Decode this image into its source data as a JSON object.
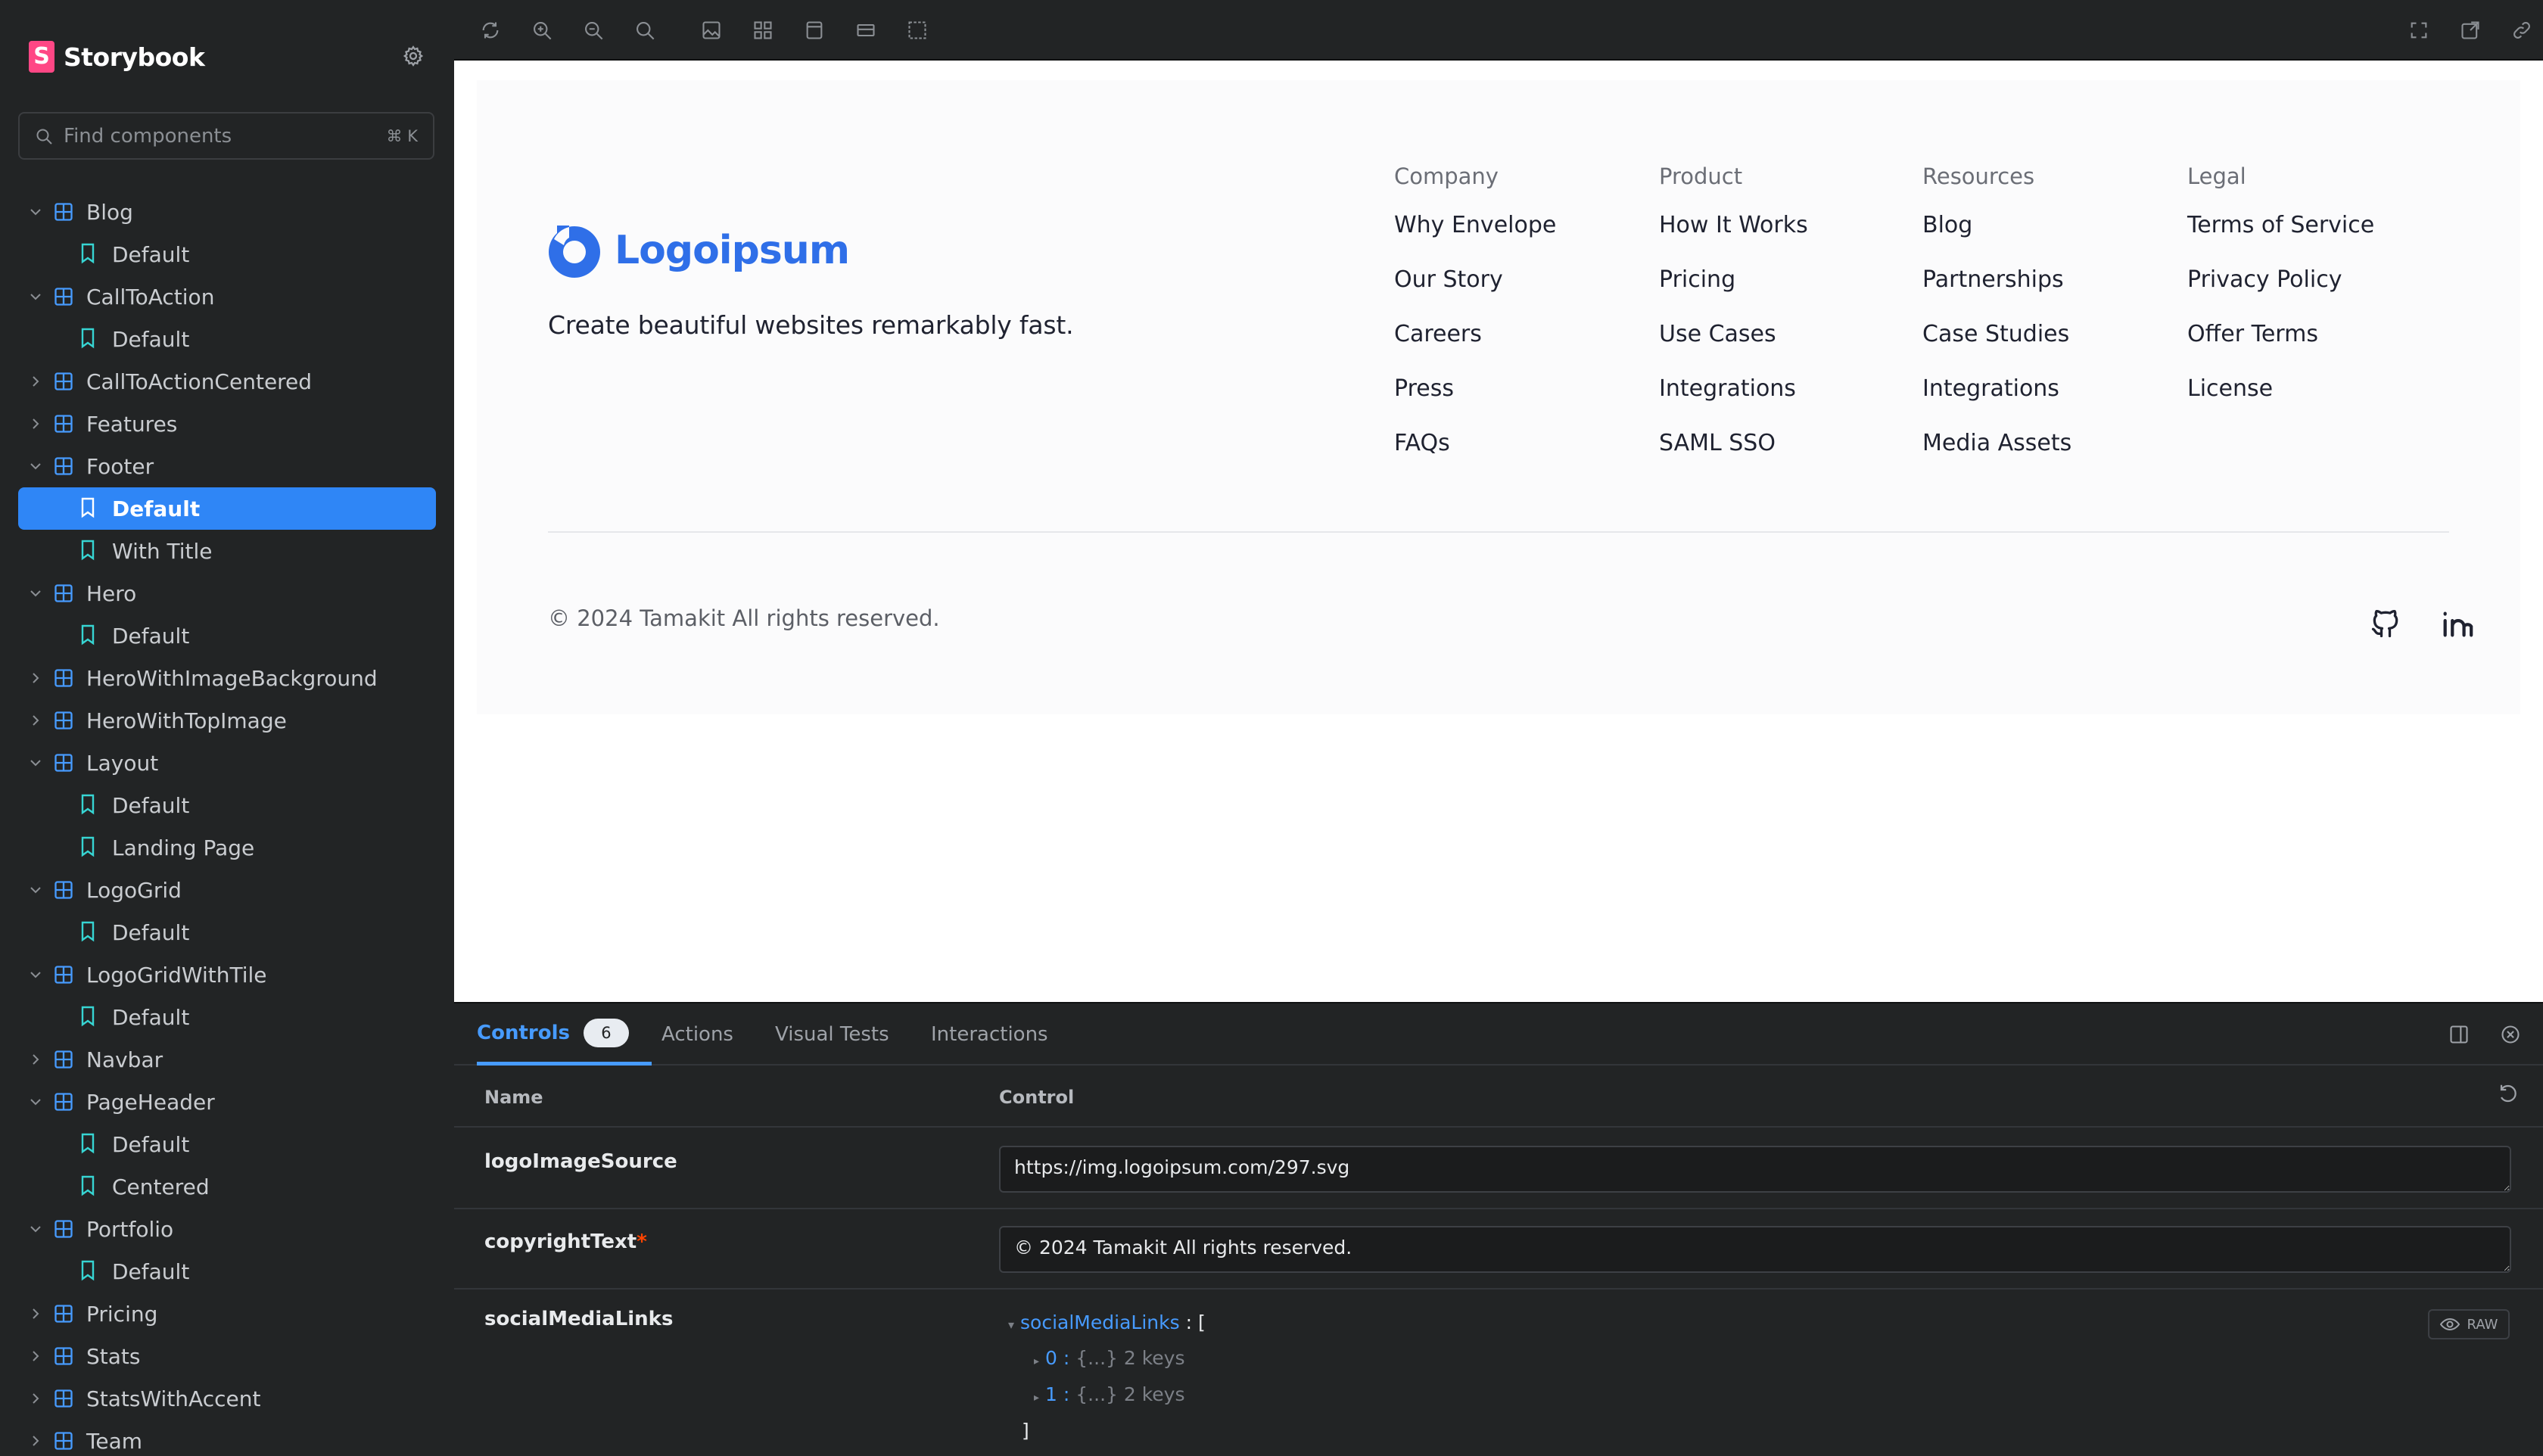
{
  "sidebar": {
    "brand": "Storybook",
    "search_placeholder": "Find components",
    "search_shortcut": "⌘ K",
    "items": [
      {
        "type": "component",
        "label": "Blog",
        "expanded": true
      },
      {
        "type": "story",
        "label": "Default"
      },
      {
        "type": "component",
        "label": "CallToAction",
        "expanded": true
      },
      {
        "type": "story",
        "label": "Default"
      },
      {
        "type": "component",
        "label": "CallToActionCentered",
        "expanded": false
      },
      {
        "type": "component",
        "label": "Features",
        "expanded": false
      },
      {
        "type": "component",
        "label": "Footer",
        "expanded": true
      },
      {
        "type": "story",
        "label": "Default",
        "selected": true
      },
      {
        "type": "story",
        "label": "With Title"
      },
      {
        "type": "component",
        "label": "Hero",
        "expanded": true
      },
      {
        "type": "story",
        "label": "Default"
      },
      {
        "type": "component",
        "label": "HeroWithImageBackground",
        "expanded": false
      },
      {
        "type": "component",
        "label": "HeroWithTopImage",
        "expanded": false
      },
      {
        "type": "component",
        "label": "Layout",
        "expanded": true
      },
      {
        "type": "story",
        "label": "Default"
      },
      {
        "type": "story",
        "label": "Landing Page"
      },
      {
        "type": "component",
        "label": "LogoGrid",
        "expanded": true
      },
      {
        "type": "story",
        "label": "Default"
      },
      {
        "type": "component",
        "label": "LogoGridWithTile",
        "expanded": true
      },
      {
        "type": "story",
        "label": "Default"
      },
      {
        "type": "component",
        "label": "Navbar",
        "expanded": false
      },
      {
        "type": "component",
        "label": "PageHeader",
        "expanded": true
      },
      {
        "type": "story",
        "label": "Default"
      },
      {
        "type": "story",
        "label": "Centered"
      },
      {
        "type": "component",
        "label": "Portfolio",
        "expanded": true
      },
      {
        "type": "story",
        "label": "Default"
      },
      {
        "type": "component",
        "label": "Pricing",
        "expanded": false
      },
      {
        "type": "component",
        "label": "Stats",
        "expanded": false
      },
      {
        "type": "component",
        "label": "StatsWithAccent",
        "expanded": false
      },
      {
        "type": "component",
        "label": "Team",
        "expanded": false
      }
    ]
  },
  "footer": {
    "logo_text": "Logoipsum",
    "tagline": "Create beautiful websites remarkably fast.",
    "columns": [
      {
        "title": "Company",
        "links": [
          "Why Envelope",
          "Our Story",
          "Careers",
          "Press",
          "FAQs"
        ]
      },
      {
        "title": "Product",
        "links": [
          "How It Works",
          "Pricing",
          "Use Cases",
          "Integrations",
          "SAML SSO"
        ]
      },
      {
        "title": "Resources",
        "links": [
          "Blog",
          "Partnerships",
          "Case Studies",
          "Integrations",
          "Media Assets"
        ]
      },
      {
        "title": "Legal",
        "links": [
          "Terms of Service",
          "Privacy Policy",
          "Offer Terms",
          "License"
        ]
      }
    ],
    "copyright": "© 2024 Tamakit All rights reserved.",
    "social": [
      "github-icon",
      "linkedin-icon"
    ]
  },
  "panel": {
    "tabs": [
      {
        "label": "Controls",
        "badge": "6",
        "active": true
      },
      {
        "label": "Actions"
      },
      {
        "label": "Visual Tests"
      },
      {
        "label": "Interactions"
      }
    ],
    "headers": {
      "name": "Name",
      "control": "Control"
    },
    "rows": {
      "logo": {
        "name": "logoImageSource",
        "value": "https://img.logoipsum.com/297.svg"
      },
      "copyright": {
        "name": "copyrightText",
        "required": "*",
        "value": "© 2024 Tamakit All rights reserved."
      },
      "social": {
        "name": "socialMediaLinks",
        "json_key": "socialMediaLinks",
        "json_open": " : [",
        "items": [
          {
            "index": "0",
            "summary": "{...} 2 keys"
          },
          {
            "index": "1",
            "summary": "{...} 2 keys"
          }
        ],
        "json_close": "]",
        "raw_label": "RAW"
      }
    }
  },
  "colors": {
    "accent": "#2f86f6",
    "brand": "#ff4785",
    "logo": "#2f6fe8",
    "teal_icon": "#37d5d3",
    "comp_icon": "#479bff"
  }
}
